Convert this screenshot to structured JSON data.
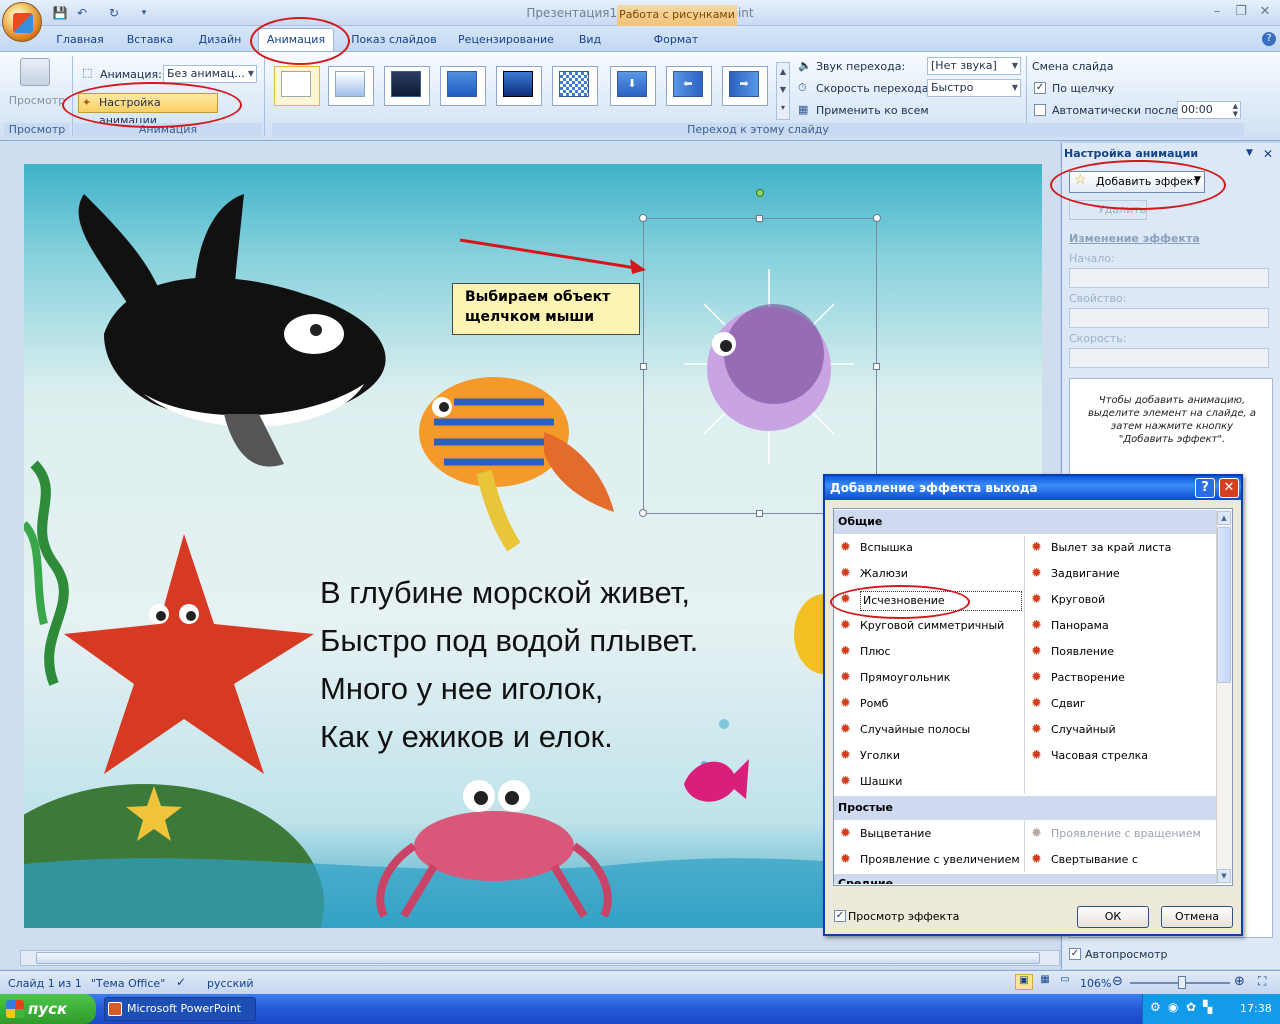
{
  "window": {
    "title": "Презентация1 - Microsoft PowerPoint",
    "context_tab": "Работа с рисунками"
  },
  "tabs": [
    "Главная",
    "Вставка",
    "Дизайн",
    "Анимация",
    "Показ слайдов",
    "Рецензирование",
    "Вид",
    "Формат"
  ],
  "ribbon": {
    "preview_label": "Просмотр",
    "preview_group": "Просмотр",
    "animation_label": "Анимация:",
    "animation_value": "Без анимац...",
    "custom_animation_button": "Настройка анимации",
    "animation_group": "Анимация",
    "transition_group": "Переход к этому слайду",
    "transition_sound_label": "Звук перехода:",
    "transition_sound_value": "[Нет звука]",
    "transition_speed_label": "Скорость перехода:",
    "transition_speed_value": "Быстро",
    "apply_all": "Применить ко всем",
    "advance_slide_label": "Смена слайда",
    "on_click": "По щелчку",
    "auto_after": "Автоматически после:",
    "auto_after_value": "00:00"
  },
  "slide": {
    "callout": "Выбираем объект щелчком мыши",
    "poem": [
      "В глубине морской живет,",
      "Быстро под водой плывет.",
      "Много у нее иголок,",
      "Как у ежиков и елок."
    ]
  },
  "task_pane": {
    "title": "Настройка анимации",
    "add_effect": "Добавить эффект",
    "remove": "Удалить",
    "modify_effect": "Изменение эффекта",
    "start_label": "Начало:",
    "property_label": "Свойство:",
    "speed_label": "Скорость:",
    "hint": "Чтобы добавить анимацию, выделите элемент на слайде, а затем нажмите кнопку \"Добавить эффект\".",
    "autopreview": "Автопросмотр"
  },
  "dialog": {
    "title": "Добавление эффекта выхода",
    "help": "?",
    "close": "✕",
    "section_general": "Общие",
    "general_left": [
      "Вспышка",
      "Жалюзи",
      "Исчезновение",
      "Круговой симметричный",
      "Плюс",
      "Прямоугольник",
      "Ромб",
      "Случайные полосы",
      "Уголки",
      "Шашки"
    ],
    "general_right": [
      "Вылет за край листа",
      "Задвигание",
      "Круговой",
      "Панорама",
      "Появление",
      "Растворение",
      "Сдвиг",
      "Случайный",
      "Часовая стрелка"
    ],
    "section_simple": "Простые",
    "simple_left": [
      "Выцветание",
      "Проявление с увеличением"
    ],
    "simple_right": [
      "Проявление с вращением",
      "Свертывание с исчезновением"
    ],
    "section_medium": "Средние",
    "preview_effect": "Просмотр эффекта",
    "ok": "ОК",
    "cancel": "Отмена"
  },
  "status": {
    "slide": "Слайд 1 из 1",
    "theme": "\"Тема Office\"",
    "language": "русский",
    "zoom": "106%"
  },
  "taskbar": {
    "start": "пуск",
    "app": "Microsoft PowerPoint ...",
    "clock": "17:38"
  },
  "colors": {
    "accent": "#15428b",
    "highlight_oval": "#d4171b",
    "dialog_title": "#0a58e0"
  }
}
